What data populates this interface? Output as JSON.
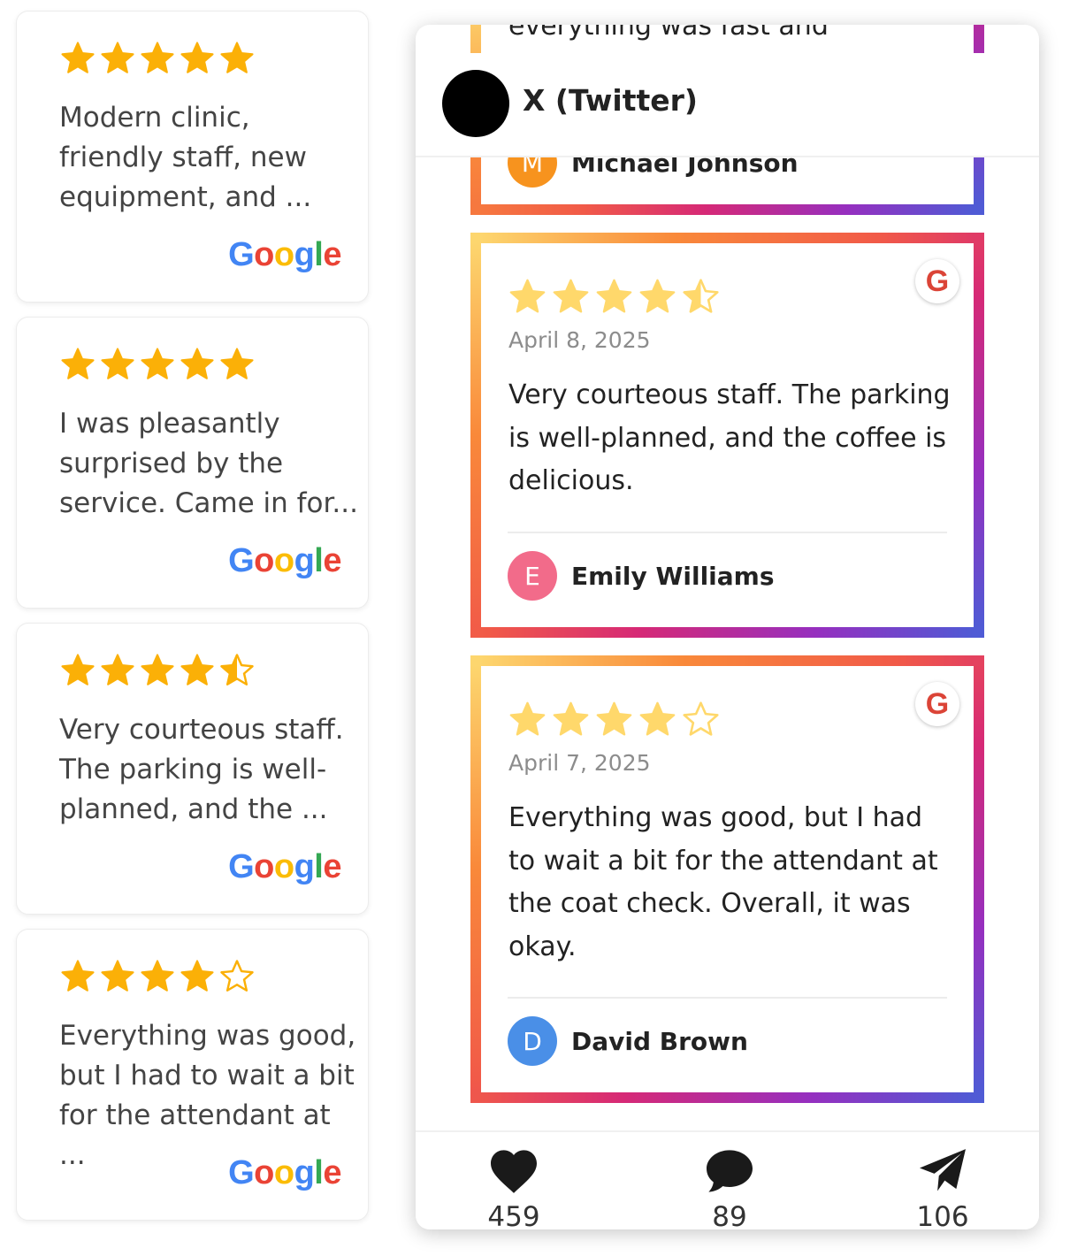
{
  "left_reviews": [
    {
      "rating": 5,
      "text": "Modern clinic, friendly staff, new equipment, and ...",
      "source": "Google"
    },
    {
      "rating": 5,
      "text": "I was pleasantly surprised by the service. Came in for...",
      "source": "Google"
    },
    {
      "rating": 4.5,
      "text": "Very courteous staff. The parking is well-planned, and the ...",
      "source": "Google"
    },
    {
      "rating": 4,
      "text": "Everything was good, but I had to wait a bit for the attendant at ...",
      "source": "Google"
    }
  ],
  "panel": {
    "title": "X (Twitter)",
    "partial_top_text": "everything was fast and professional",
    "partial_top_author": "Michael Johnson",
    "partial_top_initial": "M",
    "reviews": [
      {
        "rating": 4.5,
        "date": "April 8, 2025",
        "text": "Very courteous staff. The parking is well-planned, and the coffee is delicious.",
        "author": "Emily Williams",
        "initial": "E",
        "badge": "G"
      },
      {
        "rating": 4,
        "date": "April 7, 2025",
        "text": "Everything was good, but I had to wait a bit for the attendant at the coat check. Overall, it was okay.",
        "author": "David Brown",
        "initial": "D",
        "badge": "G"
      }
    ],
    "footer": {
      "likes": "459",
      "comments": "89",
      "shares": "106"
    }
  },
  "colors": {
    "star_left": "#FBB007",
    "star_right": "#FFD86B",
    "avatar_m": "#F7931E",
    "avatar_e": "#F26B8A",
    "avatar_d": "#4A8FE7",
    "google_badge": "#DB4437"
  },
  "icons": [
    "star-icon",
    "half-star-icon",
    "empty-star-icon",
    "google-logo",
    "heart-icon",
    "comment-icon",
    "send-icon"
  ]
}
